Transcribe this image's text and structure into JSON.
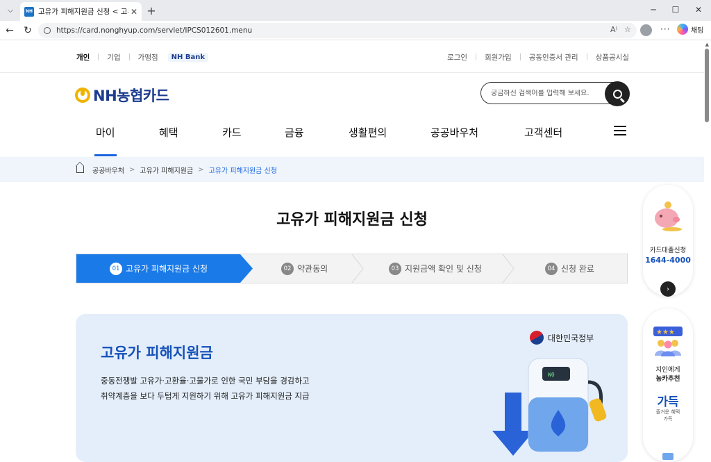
{
  "browser": {
    "tab_title": "고유가 피해지원금 신청 < 고유가",
    "favicon_text": "NH",
    "url": "https://card.nonghyup.com/servlet/IPCS012601.menu",
    "copilot_label": "채팅"
  },
  "util_nav": {
    "left": [
      "개인",
      "기업",
      "가맹점"
    ],
    "nh_bank": "NH Bank",
    "right": [
      "로그인",
      "회원가입",
      "공동인증서 관리",
      "상품공시실"
    ]
  },
  "logo_text": "NH농협카드",
  "search": {
    "placeholder": "궁금하신 검색어를 입력해 보세요."
  },
  "gnb": [
    "마이",
    "혜택",
    "카드",
    "금융",
    "생활편의",
    "공공바우처",
    "고객센터"
  ],
  "breadcrumb": [
    "공공바우처",
    "고유가 피해지원금",
    "고유가 피해지원금 신청"
  ],
  "page_title": "고유가 피해지원금 신청",
  "steps": [
    {
      "num": "01",
      "label": "고유가 피해지원금 신청"
    },
    {
      "num": "02",
      "label": "약관동의"
    },
    {
      "num": "03",
      "label": "지원금액 확인 및 신청"
    },
    {
      "num": "04",
      "label": "신청 완료"
    }
  ],
  "banner": {
    "title": "고유가 피해지원금",
    "desc_line1": "중동전쟁발 고유가·고환율·고물가로 인한 국민 부담을 경감하고",
    "desc_line2": "취약계층을 보다 두텁게 지원하기 위해 고유가 피해지원금 지급",
    "gov_label": "대한민국정부",
    "pump_display": "W0"
  },
  "side_loan": {
    "label": "카드대출신청",
    "phone": "1644-4000"
  },
  "side_referral": {
    "label1": "지인에게",
    "label2": "농카추천",
    "gadeuk": "가득",
    "gadeuk_sub1": "즐거운 혜택",
    "gadeuk_sub2": "가득"
  },
  "colors": {
    "accent": "#1a7ae8",
    "brand_navy": "#1d3c8f",
    "brand_yellow": "#f0b400",
    "banner_bg": "#e4eefb"
  }
}
